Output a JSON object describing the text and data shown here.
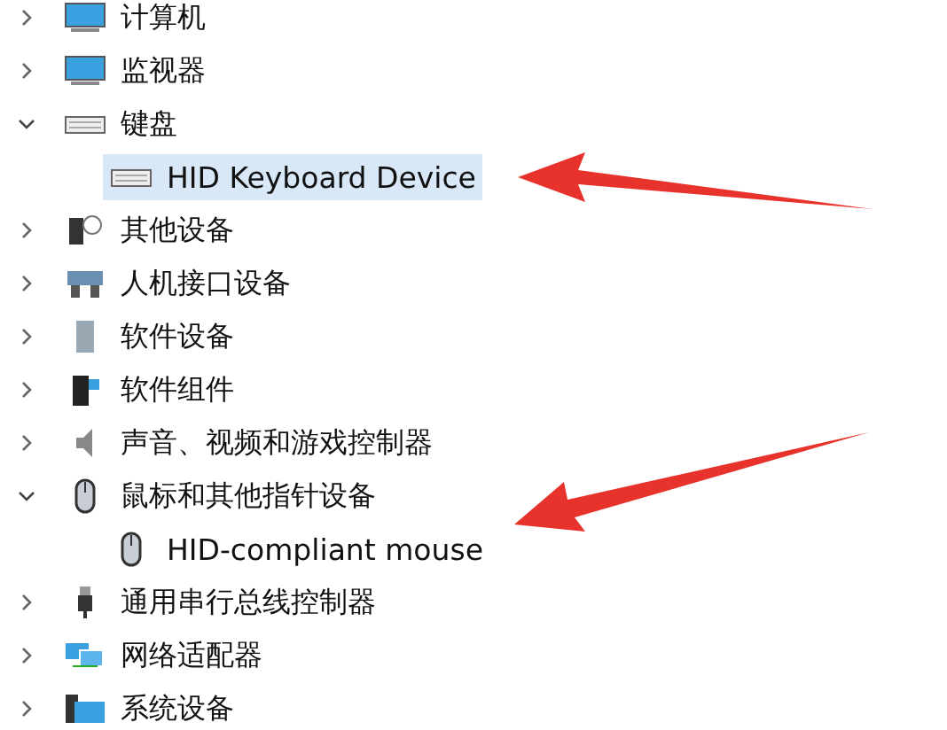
{
  "tree": [
    {
      "label": "计算机",
      "kind": "monitor",
      "expanded": false,
      "selected": false
    },
    {
      "label": "监视器",
      "kind": "monitor",
      "expanded": false,
      "selected": false
    },
    {
      "label": "键盘",
      "kind": "keyboard",
      "expanded": true,
      "selected": false,
      "children": [
        {
          "label": "HID Keyboard Device",
          "kind": "keyboard",
          "selected": true
        }
      ]
    },
    {
      "label": "其他设备",
      "kind": "unknown",
      "expanded": false,
      "selected": false
    },
    {
      "label": "人机接口设备",
      "kind": "hid",
      "expanded": false,
      "selected": false
    },
    {
      "label": "软件设备",
      "kind": "box",
      "expanded": false,
      "selected": false
    },
    {
      "label": "软件组件",
      "kind": "component",
      "expanded": false,
      "selected": false
    },
    {
      "label": "声音、视频和游戏控制器",
      "kind": "speaker",
      "expanded": false,
      "selected": false
    },
    {
      "label": "鼠标和其他指针设备",
      "kind": "mouse",
      "expanded": true,
      "selected": false,
      "children": [
        {
          "label": "HID-compliant mouse",
          "kind": "mouse",
          "selected": false
        }
      ]
    },
    {
      "label": "通用串行总线控制器",
      "kind": "usb",
      "expanded": false,
      "selected": false
    },
    {
      "label": "网络适配器",
      "kind": "network",
      "expanded": false,
      "selected": false
    },
    {
      "label": "系统设备",
      "kind": "folder",
      "expanded": false,
      "selected": false
    }
  ]
}
